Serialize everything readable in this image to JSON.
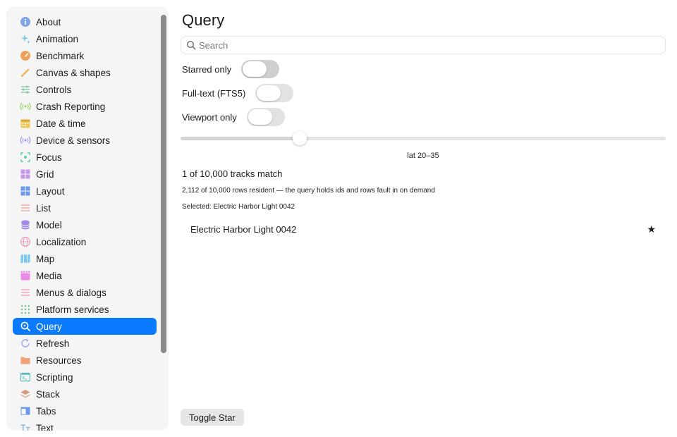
{
  "sidebar": {
    "items": [
      {
        "label": "About",
        "icon": "info-circle-icon",
        "color": "#7fa6e8"
      },
      {
        "label": "Animation",
        "icon": "sparkles-icon",
        "color": "#7cc8ef"
      },
      {
        "label": "Benchmark",
        "icon": "gauge-icon",
        "color": "#f0a25a"
      },
      {
        "label": "Canvas & shapes",
        "icon": "brush-icon",
        "color": "#f2b25a"
      },
      {
        "label": "Controls",
        "icon": "sliders-icon",
        "color": "#7fc79a"
      },
      {
        "label": "Crash Reporting",
        "icon": "broadcast-icon",
        "color": "#9ad46e"
      },
      {
        "label": "Date & time",
        "icon": "calendar-icon",
        "color": "#f2c85a"
      },
      {
        "label": "Device & sensors",
        "icon": "sensor-icon",
        "color": "#9aa0e8"
      },
      {
        "label": "Focus",
        "icon": "focus-icon",
        "color": "#5fcfa5"
      },
      {
        "label": "Grid",
        "icon": "grid-icon",
        "color": "#c79ae8"
      },
      {
        "label": "Layout",
        "icon": "layout-icon",
        "color": "#6d9ae8"
      },
      {
        "label": "List",
        "icon": "list-icon",
        "color": "#f09a9a"
      },
      {
        "label": "Model",
        "icon": "database-icon",
        "color": "#a48ae8"
      },
      {
        "label": "Localization",
        "icon": "globe-icon",
        "color": "#f0a0c0"
      },
      {
        "label": "Map",
        "icon": "map-icon",
        "color": "#7cc8ef"
      },
      {
        "label": "Media",
        "icon": "clapperboard-icon",
        "color": "#e88ae8"
      },
      {
        "label": "Menus & dialogs",
        "icon": "menu-lines-icon",
        "color": "#f0a0b8"
      },
      {
        "label": "Platform services",
        "icon": "dots-grid-icon",
        "color": "#7fc79a"
      },
      {
        "label": "Query",
        "icon": "magnifier-icon",
        "color": "#ffffff"
      },
      {
        "label": "Refresh",
        "icon": "refresh-icon",
        "color": "#9aa8e8"
      },
      {
        "label": "Resources",
        "icon": "folder-icon",
        "color": "#f0a07a"
      },
      {
        "label": "Scripting",
        "icon": "terminal-icon",
        "color": "#5fb8b8"
      },
      {
        "label": "Stack",
        "icon": "stack-icon",
        "color": "#d09a7a"
      },
      {
        "label": "Tabs",
        "icon": "tabs-icon",
        "color": "#6d9ae8"
      },
      {
        "label": "Text",
        "icon": "text-icon",
        "color": "#8ab8e8"
      }
    ],
    "selected": "Query",
    "accent": "#0a7aff"
  },
  "main": {
    "title": "Query",
    "search": {
      "placeholder": "Search",
      "value": ""
    },
    "toggles": [
      {
        "label": "Starred only",
        "on": false
      },
      {
        "label": "Full-text (FTS5)",
        "on": false
      },
      {
        "label": "Viewport only",
        "on": false
      }
    ],
    "slider": {
      "fraction": 0.245,
      "value_label": "lat 20–35"
    },
    "match_count": "1 of 10,000 tracks match",
    "resident_note": "2,112 of 10,000 rows resident — the query holds ids and rows fault in on demand",
    "selected_note": "Selected: Electric Harbor Light 0042",
    "results": [
      {
        "title": "Electric Harbor Light 0042",
        "star": "★"
      }
    ],
    "toggle_star_label": "Toggle Star"
  }
}
